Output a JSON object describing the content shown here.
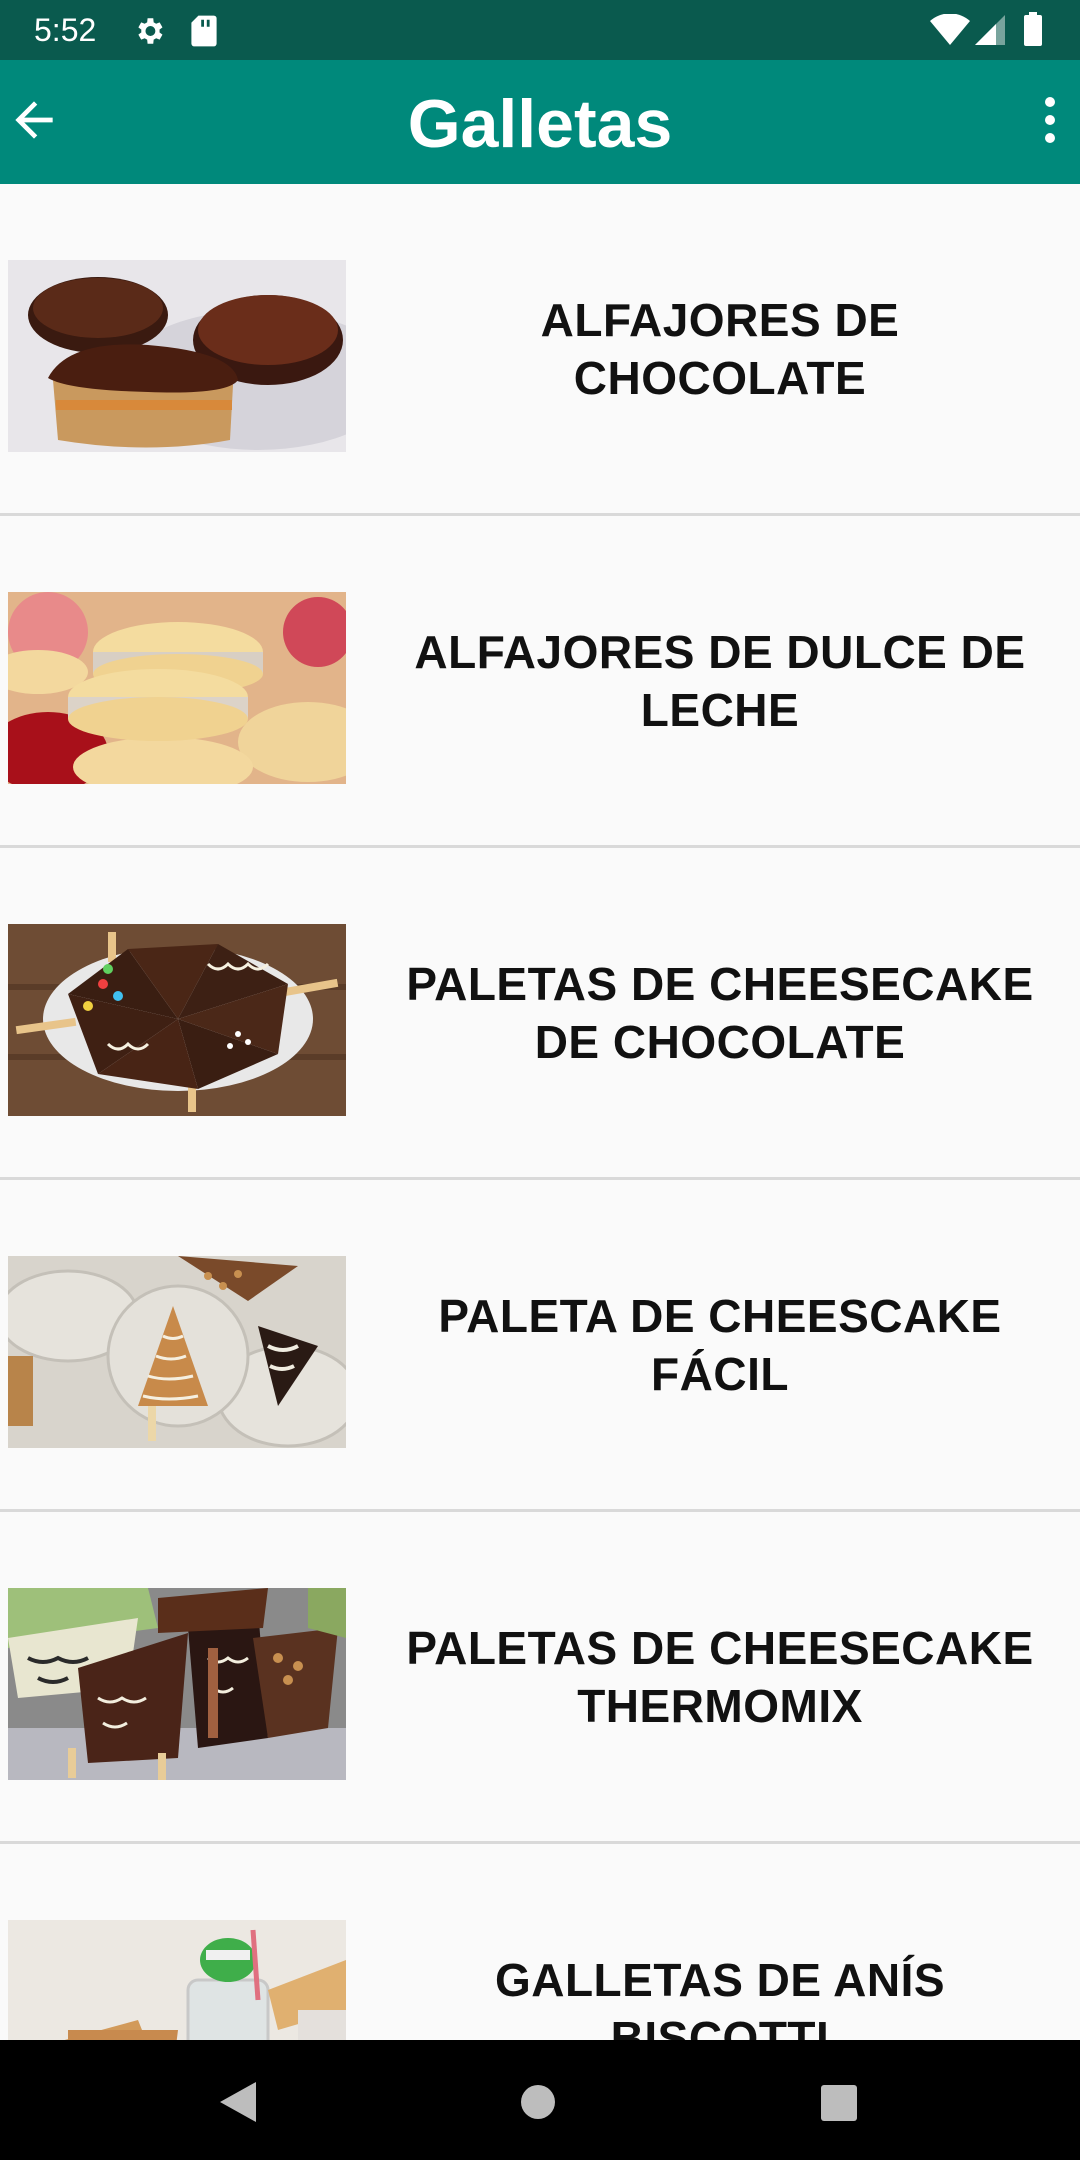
{
  "status_bar": {
    "time": "5:52"
  },
  "app_bar": {
    "title": "Galletas"
  },
  "recipes": [
    {
      "title": "ALFAJORES DE CHOCOLATE"
    },
    {
      "title": "ALFAJORES DE DULCE DE LECHE"
    },
    {
      "title": "PALETAS DE CHEESECAKE DE CHOCOLATE"
    },
    {
      "title": "PALETA DE CHEESCAKE FÁCIL"
    },
    {
      "title": "PALETAS DE CHEESECAKE THERMOMIX"
    },
    {
      "title": "GALLETAS DE ANÍS BISCOTTI"
    }
  ],
  "colors": {
    "status_bar": "#0a5a4e",
    "app_bar": "#00897b"
  }
}
